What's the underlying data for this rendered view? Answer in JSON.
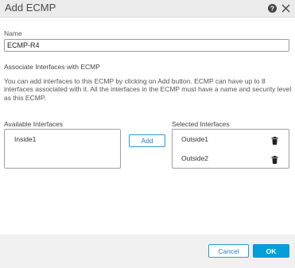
{
  "dialog": {
    "title": "Add ECMP",
    "help_icon": "question-circle-icon",
    "close_icon": "close-icon"
  },
  "name_field": {
    "label": "Name",
    "value": "ECMP-R4"
  },
  "associate": {
    "heading": "Associate Interfaces with ECMP",
    "description": "You can add interfaces to this ECMP by clicking on Add button. ECMP can have up to 8 interfaces associated with it. All the interfaces in the ECMP must have a name and security level as this ECMP."
  },
  "available": {
    "label": "Available Interfaces",
    "items": [
      "Inside1"
    ]
  },
  "selected": {
    "label": "Selected Interfaces",
    "items": [
      "Outside1",
      "Outside2"
    ],
    "remove_icon": "trash-icon"
  },
  "add_button_label": "Add",
  "footer": {
    "cancel_label": "Cancel",
    "ok_label": "OK"
  },
  "colors": {
    "accent": "#049fd9",
    "title_bar": "#ebebeb",
    "footer": "#f0f0f0"
  }
}
